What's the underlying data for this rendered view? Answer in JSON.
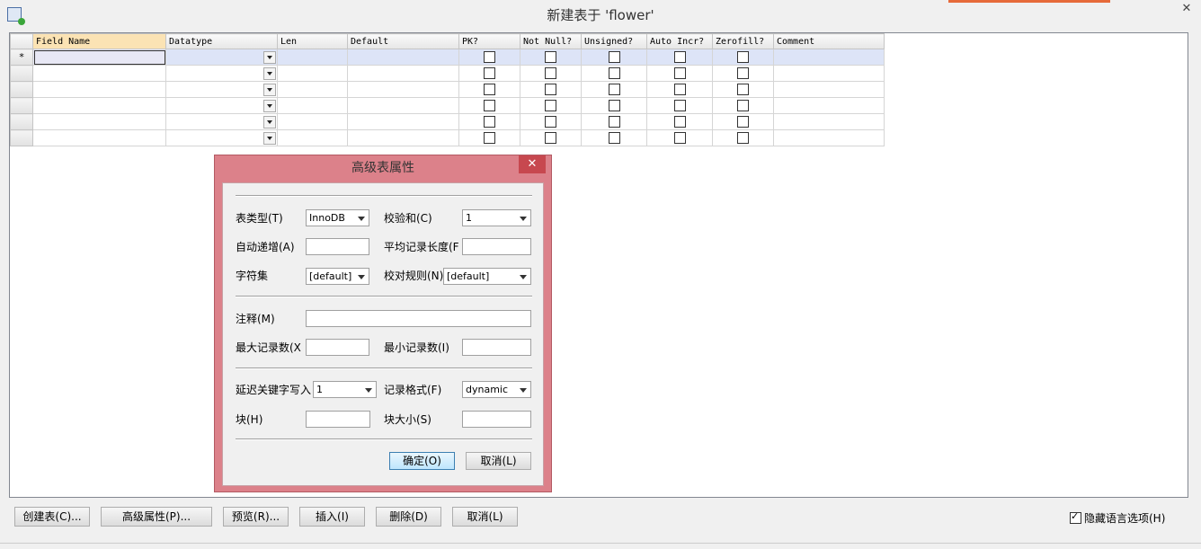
{
  "window": {
    "title": "新建表于 'flower'",
    "close": "✕"
  },
  "grid": {
    "columns": [
      {
        "label": "Field Name",
        "width": 148
      },
      {
        "label": "Datatype",
        "width": 124
      },
      {
        "label": "Len",
        "width": 78
      },
      {
        "label": "Default",
        "width": 124
      },
      {
        "label": "PK?",
        "width": 68
      },
      {
        "label": "Not Null?",
        "width": 68
      },
      {
        "label": "Unsigned?",
        "width": 73
      },
      {
        "label": "Auto Incr?",
        "width": 73
      },
      {
        "label": "Zerofill?",
        "width": 68
      },
      {
        "label": "Comment",
        "width": 123
      }
    ],
    "row_marker": "*",
    "row_count": 6
  },
  "dialog": {
    "title": "高级表属性",
    "close": "✕",
    "table_type_label": "表类型(T)",
    "table_type_value": "InnoDB",
    "checksum_label": "校验和(C)",
    "checksum_value": "1",
    "auto_incr_label": "自动递增(A)",
    "avg_row_len_label": "平均记录长度(F",
    "charset_label": "字符集",
    "charset_value": "[default]",
    "collation_label": "校对规则(N)",
    "collation_value": "[default]",
    "comment_label": "注释(M)",
    "max_rows_label": "最大记录数(X",
    "min_rows_label": "最小记录数(I)",
    "delay_key_label": "延迟关键字写入",
    "delay_key_value": "1",
    "row_format_label": "记录格式(F)",
    "row_format_value": "dynamic",
    "block_label": "块(H)",
    "block_size_label": "块大小(S)",
    "ok_label": "确定(O)",
    "cancel_label": "取消(L)"
  },
  "bottom": {
    "create_table": "创建表(C)...",
    "advanced": "高级属性(P)...",
    "preview": "预览(R)...",
    "insert": "插入(I)",
    "delete": "删除(D)",
    "cancel": "取消(L)",
    "hide_language": "隐藏语言选项(H)"
  }
}
